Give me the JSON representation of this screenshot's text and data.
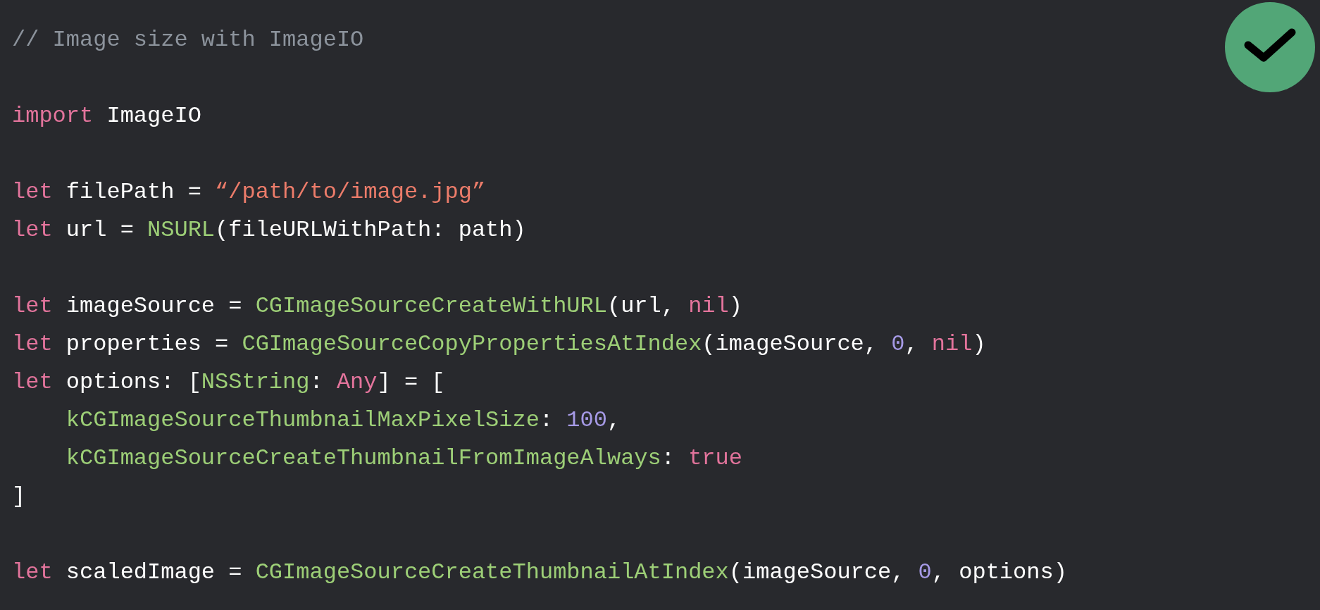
{
  "code_blocks": [
    [
      [
        {
          "kind": "comment",
          "text": "// Image size with ImageIO"
        }
      ]
    ],
    [
      [
        {
          "kind": "keyword",
          "text": "import"
        },
        {
          "kind": "plain",
          "text": " ImageIO"
        }
      ]
    ],
    [
      [
        {
          "kind": "keyword",
          "text": "let"
        },
        {
          "kind": "plain",
          "text": " filePath = "
        },
        {
          "kind": "string",
          "text": "“/path/to/image.jpg”"
        }
      ],
      [
        {
          "kind": "keyword",
          "text": "let"
        },
        {
          "kind": "plain",
          "text": " url = "
        },
        {
          "kind": "type",
          "text": "NSURL"
        },
        {
          "kind": "plain",
          "text": "(fileURLWithPath: path)"
        }
      ]
    ],
    [
      [
        {
          "kind": "keyword",
          "text": "let"
        },
        {
          "kind": "plain",
          "text": " imageSource = "
        },
        {
          "kind": "type",
          "text": "CGImageSourceCreateWithURL"
        },
        {
          "kind": "plain",
          "text": "(url, "
        },
        {
          "kind": "keyword",
          "text": "nil"
        },
        {
          "kind": "plain",
          "text": ")"
        }
      ],
      [
        {
          "kind": "keyword",
          "text": "let"
        },
        {
          "kind": "plain",
          "text": " properties = "
        },
        {
          "kind": "type",
          "text": "CGImageSourceCopyPropertiesAtIndex"
        },
        {
          "kind": "plain",
          "text": "(imageSource, "
        },
        {
          "kind": "number",
          "text": "0"
        },
        {
          "kind": "plain",
          "text": ", "
        },
        {
          "kind": "keyword",
          "text": "nil"
        },
        {
          "kind": "plain",
          "text": ")"
        }
      ],
      [
        {
          "kind": "keyword",
          "text": "let"
        },
        {
          "kind": "plain",
          "text": " options: ["
        },
        {
          "kind": "type",
          "text": "NSString"
        },
        {
          "kind": "plain",
          "text": ": "
        },
        {
          "kind": "keyword",
          "text": "Any"
        },
        {
          "kind": "plain",
          "text": "] = ["
        }
      ],
      [
        {
          "kind": "type",
          "text": "    kCGImageSourceThumbnailMaxPixelSize"
        },
        {
          "kind": "plain",
          "text": ": "
        },
        {
          "kind": "number",
          "text": "100"
        },
        {
          "kind": "plain",
          "text": ","
        }
      ],
      [
        {
          "kind": "type",
          "text": "    kCGImageSourceCreateThumbnailFromImageAlways"
        },
        {
          "kind": "plain",
          "text": ": "
        },
        {
          "kind": "keyword",
          "text": "true"
        }
      ],
      [
        {
          "kind": "plain",
          "text": "]"
        }
      ]
    ],
    [
      [
        {
          "kind": "keyword",
          "text": "let"
        },
        {
          "kind": "plain",
          "text": " scaledImage = "
        },
        {
          "kind": "type",
          "text": "CGImageSourceCreateThumbnailAtIndex"
        },
        {
          "kind": "plain",
          "text": "(imageSource, "
        },
        {
          "kind": "number",
          "text": "0"
        },
        {
          "kind": "plain",
          "text": ", options)"
        }
      ]
    ]
  ]
}
